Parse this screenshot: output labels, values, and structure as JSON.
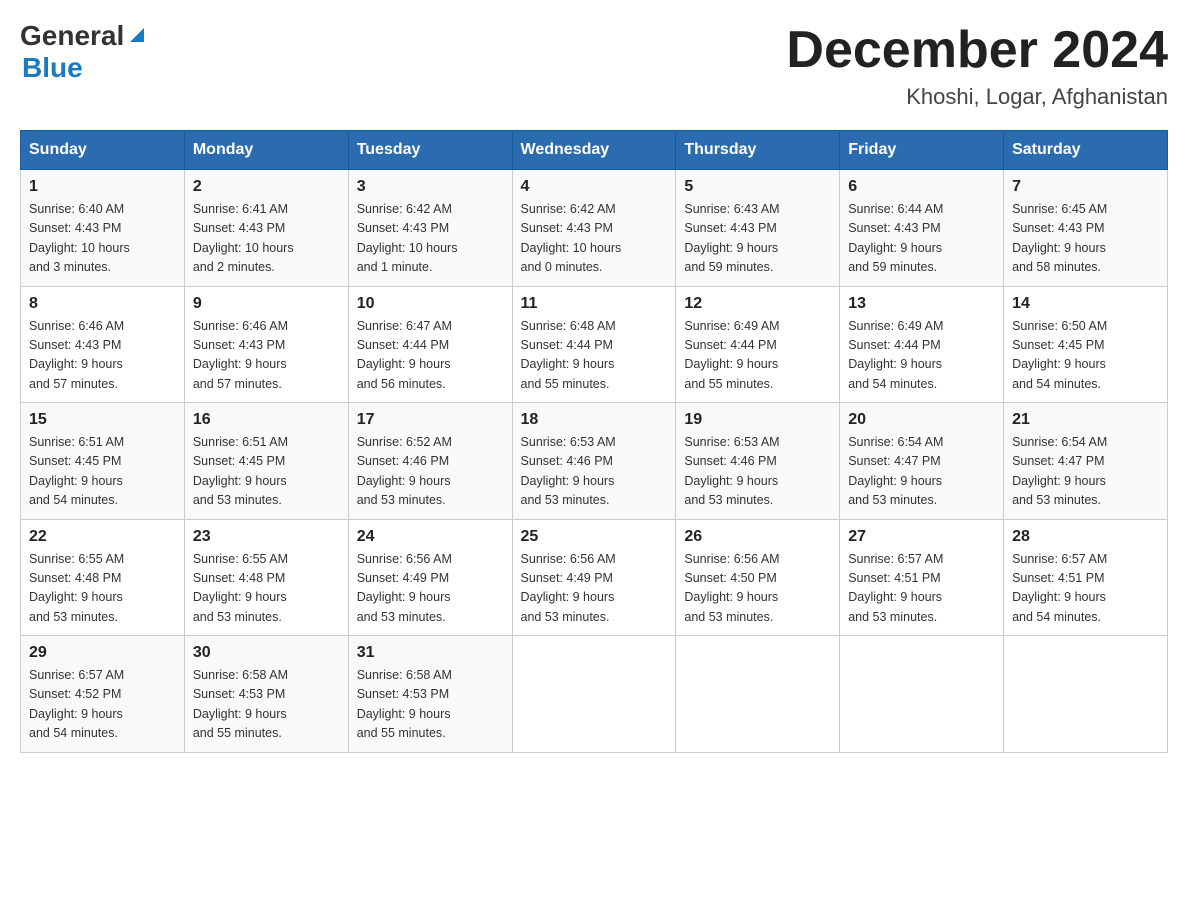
{
  "logo": {
    "general": "General",
    "blue": "Blue"
  },
  "header": {
    "month": "December 2024",
    "location": "Khoshi, Logar, Afghanistan"
  },
  "days_of_week": [
    "Sunday",
    "Monday",
    "Tuesday",
    "Wednesday",
    "Thursday",
    "Friday",
    "Saturday"
  ],
  "weeks": [
    [
      {
        "day": "1",
        "sunrise": "6:40 AM",
        "sunset": "4:43 PM",
        "daylight": "10 hours and 3 minutes."
      },
      {
        "day": "2",
        "sunrise": "6:41 AM",
        "sunset": "4:43 PM",
        "daylight": "10 hours and 2 minutes."
      },
      {
        "day": "3",
        "sunrise": "6:42 AM",
        "sunset": "4:43 PM",
        "daylight": "10 hours and 1 minute."
      },
      {
        "day": "4",
        "sunrise": "6:42 AM",
        "sunset": "4:43 PM",
        "daylight": "10 hours and 0 minutes."
      },
      {
        "day": "5",
        "sunrise": "6:43 AM",
        "sunset": "4:43 PM",
        "daylight": "9 hours and 59 minutes."
      },
      {
        "day": "6",
        "sunrise": "6:44 AM",
        "sunset": "4:43 PM",
        "daylight": "9 hours and 59 minutes."
      },
      {
        "day": "7",
        "sunrise": "6:45 AM",
        "sunset": "4:43 PM",
        "daylight": "9 hours and 58 minutes."
      }
    ],
    [
      {
        "day": "8",
        "sunrise": "6:46 AM",
        "sunset": "4:43 PM",
        "daylight": "9 hours and 57 minutes."
      },
      {
        "day": "9",
        "sunrise": "6:46 AM",
        "sunset": "4:43 PM",
        "daylight": "9 hours and 57 minutes."
      },
      {
        "day": "10",
        "sunrise": "6:47 AM",
        "sunset": "4:44 PM",
        "daylight": "9 hours and 56 minutes."
      },
      {
        "day": "11",
        "sunrise": "6:48 AM",
        "sunset": "4:44 PM",
        "daylight": "9 hours and 55 minutes."
      },
      {
        "day": "12",
        "sunrise": "6:49 AM",
        "sunset": "4:44 PM",
        "daylight": "9 hours and 55 minutes."
      },
      {
        "day": "13",
        "sunrise": "6:49 AM",
        "sunset": "4:44 PM",
        "daylight": "9 hours and 54 minutes."
      },
      {
        "day": "14",
        "sunrise": "6:50 AM",
        "sunset": "4:45 PM",
        "daylight": "9 hours and 54 minutes."
      }
    ],
    [
      {
        "day": "15",
        "sunrise": "6:51 AM",
        "sunset": "4:45 PM",
        "daylight": "9 hours and 54 minutes."
      },
      {
        "day": "16",
        "sunrise": "6:51 AM",
        "sunset": "4:45 PM",
        "daylight": "9 hours and 53 minutes."
      },
      {
        "day": "17",
        "sunrise": "6:52 AM",
        "sunset": "4:46 PM",
        "daylight": "9 hours and 53 minutes."
      },
      {
        "day": "18",
        "sunrise": "6:53 AM",
        "sunset": "4:46 PM",
        "daylight": "9 hours and 53 minutes."
      },
      {
        "day": "19",
        "sunrise": "6:53 AM",
        "sunset": "4:46 PM",
        "daylight": "9 hours and 53 minutes."
      },
      {
        "day": "20",
        "sunrise": "6:54 AM",
        "sunset": "4:47 PM",
        "daylight": "9 hours and 53 minutes."
      },
      {
        "day": "21",
        "sunrise": "6:54 AM",
        "sunset": "4:47 PM",
        "daylight": "9 hours and 53 minutes."
      }
    ],
    [
      {
        "day": "22",
        "sunrise": "6:55 AM",
        "sunset": "4:48 PM",
        "daylight": "9 hours and 53 minutes."
      },
      {
        "day": "23",
        "sunrise": "6:55 AM",
        "sunset": "4:48 PM",
        "daylight": "9 hours and 53 minutes."
      },
      {
        "day": "24",
        "sunrise": "6:56 AM",
        "sunset": "4:49 PM",
        "daylight": "9 hours and 53 minutes."
      },
      {
        "day": "25",
        "sunrise": "6:56 AM",
        "sunset": "4:49 PM",
        "daylight": "9 hours and 53 minutes."
      },
      {
        "day": "26",
        "sunrise": "6:56 AM",
        "sunset": "4:50 PM",
        "daylight": "9 hours and 53 minutes."
      },
      {
        "day": "27",
        "sunrise": "6:57 AM",
        "sunset": "4:51 PM",
        "daylight": "9 hours and 53 minutes."
      },
      {
        "day": "28",
        "sunrise": "6:57 AM",
        "sunset": "4:51 PM",
        "daylight": "9 hours and 54 minutes."
      }
    ],
    [
      {
        "day": "29",
        "sunrise": "6:57 AM",
        "sunset": "4:52 PM",
        "daylight": "9 hours and 54 minutes."
      },
      {
        "day": "30",
        "sunrise": "6:58 AM",
        "sunset": "4:53 PM",
        "daylight": "9 hours and 55 minutes."
      },
      {
        "day": "31",
        "sunrise": "6:58 AM",
        "sunset": "4:53 PM",
        "daylight": "9 hours and 55 minutes."
      },
      null,
      null,
      null,
      null
    ]
  ],
  "labels": {
    "sunrise": "Sunrise:",
    "sunset": "Sunset:",
    "daylight": "Daylight:"
  }
}
